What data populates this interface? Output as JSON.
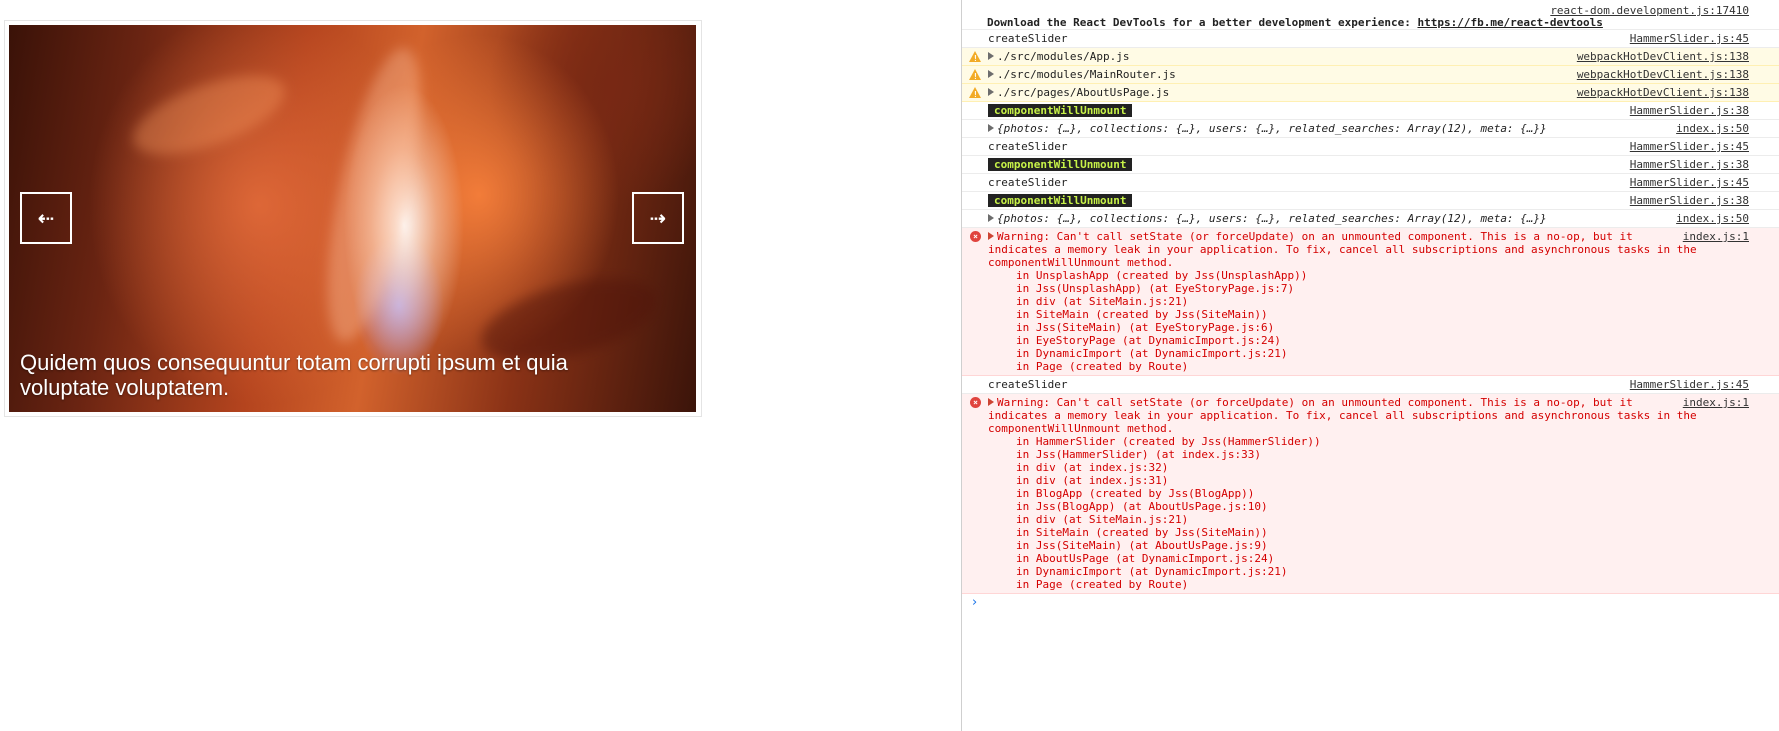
{
  "slider": {
    "prev_label": "⇠",
    "next_label": "⇢",
    "caption": "Quidem quos consequuntur totam corrupti ipsum et quia voluptate voluptatem."
  },
  "console": {
    "devtools_source": "react-dom.development.js:17410",
    "devtools_msg": "Download the React DevTools for a better development experience: ",
    "devtools_link": "https://fb.me/react-devtools",
    "entries": [
      {
        "text": "createSlider",
        "src": "HammerSlider.js:45"
      },
      {
        "text": "./src/modules/App.js",
        "src": "webpackHotDevClient.js:138"
      },
      {
        "text": "./src/modules/MainRouter.js",
        "src": "webpackHotDevClient.js:138"
      },
      {
        "text": "./src/pages/AboutUsPage.js",
        "src": "webpackHotDevClient.js:138"
      },
      {
        "text": "componentWillUnmount",
        "src": "HammerSlider.js:38"
      },
      {
        "text": "{photos: {…}, collections: {…}, users: {…}, related_searches: Array(12), meta: {…}}",
        "src": "index.js:50"
      },
      {
        "text": "createSlider",
        "src": "HammerSlider.js:45"
      },
      {
        "text": "componentWillUnmount",
        "src": "HammerSlider.js:38"
      },
      {
        "text": "createSlider",
        "src": "HammerSlider.js:45"
      },
      {
        "text": "componentWillUnmount",
        "src": "HammerSlider.js:38"
      },
      {
        "text": "{photos: {…}, collections: {…}, users: {…}, related_searches: Array(12), meta: {…}}",
        "src": "index.js:50"
      }
    ],
    "error1": {
      "msg": "Warning: Can't call setState (or forceUpdate) on an unmounted component. This is a no-op, but it\nindicates a memory leak in your application. To fix, cancel all subscriptions and asynchronous tasks in the\ncomponentWillUnmount method.",
      "src": "index.js:1",
      "stack": [
        "in UnsplashApp (created by Jss(UnsplashApp))",
        "in Jss(UnsplashApp) (at EyeStoryPage.js:7)",
        "in div (at SiteMain.js:21)",
        "in SiteMain (created by Jss(SiteMain))",
        "in Jss(SiteMain) (at EyeStoryPage.js:6)",
        "in EyeStoryPage (at DynamicImport.js:24)",
        "in DynamicImport (at DynamicImport.js:21)",
        "in Page (created by Route)"
      ]
    },
    "after_error1": {
      "text": "createSlider",
      "src": "HammerSlider.js:45"
    },
    "error2": {
      "msg": "Warning: Can't call setState (or forceUpdate) on an unmounted component. This is a no-op, but it\nindicates a memory leak in your application. To fix, cancel all subscriptions and asynchronous tasks in the\ncomponentWillUnmount method.",
      "src": "index.js:1",
      "stack": [
        "in HammerSlider (created by Jss(HammerSlider))",
        "in Jss(HammerSlider) (at index.js:33)",
        "in div (at index.js:32)",
        "in div (at index.js:31)",
        "in BlogApp (created by Jss(BlogApp))",
        "in Jss(BlogApp) (at AboutUsPage.js:10)",
        "in div (at SiteMain.js:21)",
        "in SiteMain (created by Jss(SiteMain))",
        "in Jss(SiteMain) (at AboutUsPage.js:9)",
        "in AboutUsPage (at DynamicImport.js:24)",
        "in DynamicImport (at DynamicImport.js:21)",
        "in Page (created by Route)"
      ]
    },
    "prompt": "›"
  }
}
